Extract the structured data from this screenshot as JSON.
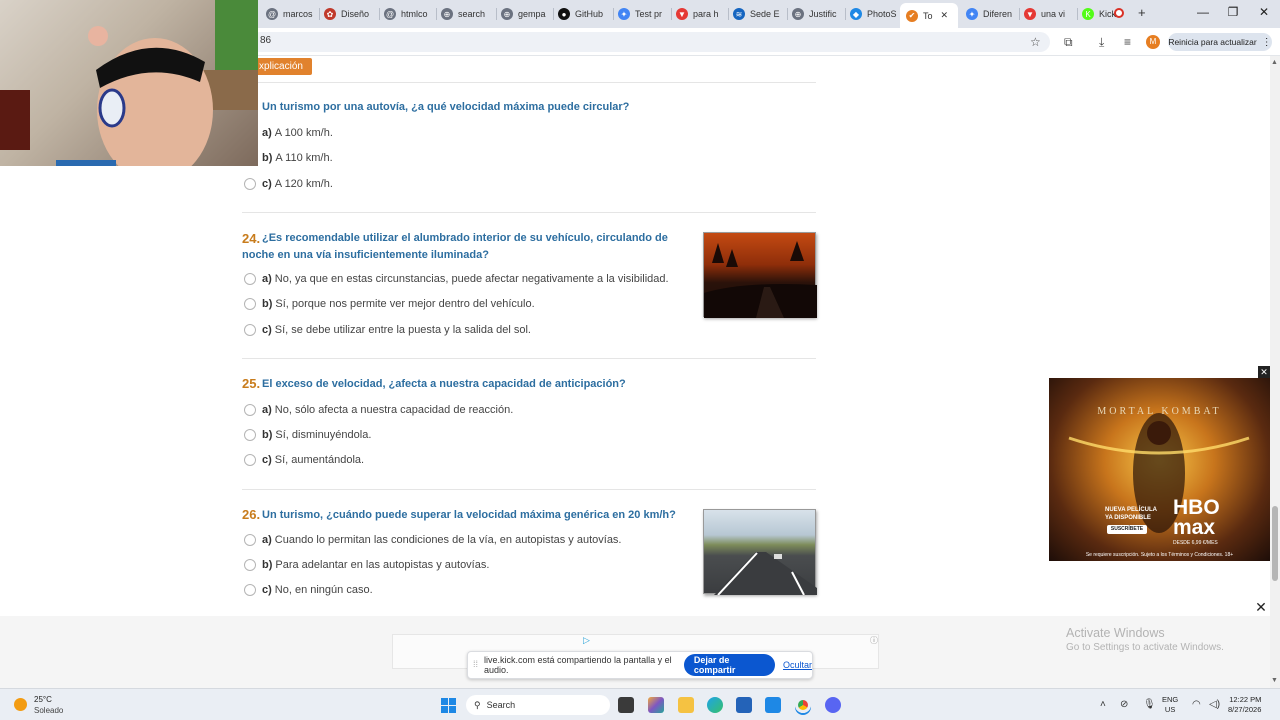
{
  "browser": {
    "tabs": [
      {
        "label": "marcos",
        "color": "#6b7280",
        "glyph": "@"
      },
      {
        "label": "Diseño",
        "color": "#c0392b",
        "glyph": "✿"
      },
      {
        "label": "htmlco",
        "color": "#6b7280",
        "glyph": "@"
      },
      {
        "label": "search",
        "color": "#6b7280",
        "glyph": "⊕"
      },
      {
        "label": "gempa",
        "color": "#6b7280",
        "glyph": "⊕"
      },
      {
        "label": "GitHub",
        "color": "#111111",
        "glyph": "●"
      },
      {
        "label": "Test pr",
        "color": "#4285f4",
        "glyph": "✦"
      },
      {
        "label": "para h",
        "color": "#e53935",
        "glyph": "▼"
      },
      {
        "label": "Sede E",
        "color": "#1565c0",
        "glyph": "≋"
      },
      {
        "label": "Justific",
        "color": "#6b7280",
        "glyph": "⊕"
      },
      {
        "label": "PhotoS",
        "color": "#1e88e5",
        "glyph": "◆"
      },
      {
        "label": "To",
        "color": "#e67e22",
        "glyph": "✔"
      },
      {
        "label": "Diferen",
        "color": "#4285f4",
        "glyph": "✦"
      },
      {
        "label": "una vi",
        "color": "#e53935",
        "glyph": "▼"
      },
      {
        "label": "Kick",
        "color": "#53fc18",
        "glyph": "K"
      }
    ],
    "active_tab_index": 11,
    "url": "86",
    "update_label": "Reinicia para actualizar",
    "avatar_initial": "M"
  },
  "page": {
    "explain_button": "xplicación",
    "questions": [
      {
        "number": "",
        "text": "Un turismo por una autovía, ¿a qué velocidad máxima puede circular?",
        "options": [
          {
            "letter": "a)",
            "text": "A 100 km/h."
          },
          {
            "letter": "b)",
            "text": "A 110 km/h."
          },
          {
            "letter": "c)",
            "text": "A 120 km/h."
          }
        ]
      },
      {
        "number": "24.",
        "text": "¿Es recomendable utilizar el alumbrado interior de su vehículo, circulando de noche en una vía insuficientemente iluminada?",
        "options": [
          {
            "letter": "a)",
            "text": "No, ya que en estas circunstancias, puede afectar negativamente a la visibilidad."
          },
          {
            "letter": "b)",
            "text": "Sí, porque nos permite ver mejor dentro del vehículo."
          },
          {
            "letter": "c)",
            "text": "Sí, se debe utilizar entre la puesta y la salida del sol."
          }
        ]
      },
      {
        "number": "25.",
        "text": "El exceso de velocidad, ¿afecta a nuestra capacidad de anticipación?",
        "options": [
          {
            "letter": "a)",
            "text": "No, sólo afecta a nuestra capacidad de reacción."
          },
          {
            "letter": "b)",
            "text": "Sí, disminuyéndola."
          },
          {
            "letter": "c)",
            "text": "Sí, aumentándola."
          }
        ]
      },
      {
        "number": "26.",
        "text": "Un turismo, ¿cuándo puede superar la velocidad máxima genérica en 20 km/h?",
        "options": [
          {
            "letter": "a)",
            "text": "Cuando lo permitan las condiciones de la vía, en autopistas y autovías."
          },
          {
            "letter": "b)",
            "text": "Para adelantar en las autopistas y autovías."
          },
          {
            "letter": "c)",
            "text": "No, en ningún caso."
          }
        ]
      }
    ]
  },
  "ad": {
    "title": "MORTAL KOMBAT",
    "film_line1": "NUEVA PELÍCULA",
    "film_line2": "YA DISPONIBLE",
    "subscribe": "SUSCRÍBETE",
    "brand_line1": "HBO",
    "brand_line2": "max",
    "price": "DESDE 6,99 €/MES",
    "legal": "Se requiere suscripción. Sujeto a los Términos y Condiciones. 18+"
  },
  "share": {
    "text": "live.kick.com está compartiendo la pantalla y el audio.",
    "stop_label": "Dejar de compartir",
    "hide_label": "Ocultar"
  },
  "activate_windows": {
    "line1": "Activate Windows",
    "line2": "Go to Settings to activate Windows."
  },
  "taskbar": {
    "temperature": "25°C",
    "weather": "Soleado",
    "search_placeholder": "Search",
    "lang_line1": "ENG",
    "lang_line2": "US",
    "time": "12:22 PM",
    "date": "8/27/2026"
  }
}
